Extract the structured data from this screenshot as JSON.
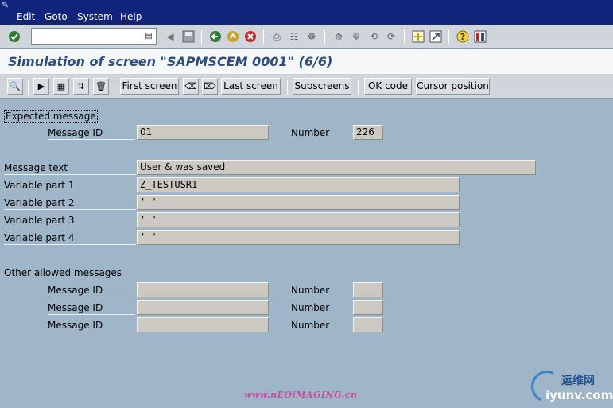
{
  "menubar": {
    "items": [
      {
        "label": "Edit",
        "mnemonic": "E"
      },
      {
        "label": "Goto",
        "mnemonic": "G"
      },
      {
        "label": "System",
        "mnemonic": "S"
      },
      {
        "label": "Help",
        "mnemonic": "H"
      }
    ]
  },
  "toolbar": {
    "command_value": "",
    "icons": [
      "enter-icon",
      "back-icon",
      "exit-icon",
      "cancel-icon",
      "print-icon",
      "find-icon",
      "find-next-icon",
      "first-page-icon",
      "previous-page-icon",
      "next-page-icon",
      "last-page-icon",
      "create-session-icon",
      "shortcut-icon",
      "help-icon",
      "layout-menu-icon"
    ]
  },
  "title": "Simulation of screen \"SAPMSCEM 0001\" (6/6)",
  "app_toolbar": {
    "first_screen": "First screen",
    "last_screen": "Last screen",
    "subscreens": "Subscreens",
    "ok_code": "OK code",
    "cursor_position": "Cursor position"
  },
  "expected": {
    "group_label": "Expected message",
    "message_id_label": "Message ID",
    "message_id": "01",
    "number_label": "Number",
    "number": "226",
    "message_text_label": "Message text",
    "message_text": "User & was saved",
    "var1_label": "Variable part 1",
    "var1": "Z_TESTUSR1",
    "var2_label": "Variable part 2",
    "var2": "' '",
    "var3_label": "Variable part 3",
    "var3": "' '",
    "var4_label": "Variable part 4",
    "var4": "' '"
  },
  "other": {
    "group_label": "Other allowed messages",
    "rows": [
      {
        "message_id_label": "Message ID",
        "message_id": "",
        "number_label": "Number",
        "number": ""
      },
      {
        "message_id_label": "Message ID",
        "message_id": "",
        "number_label": "Number",
        "number": ""
      },
      {
        "message_id_label": "Message ID",
        "message_id": "",
        "number_label": "Number",
        "number": ""
      }
    ]
  },
  "watermarks": {
    "center": "www.nEOiMAGING.cn",
    "corner_cn": "运维网",
    "corner_en": "iyunv.com"
  },
  "colors": {
    "menubar_bg": "#10247c",
    "title_color": "#2a4e83",
    "screen_bg": "#9eb6c8",
    "field_bg": "#cbc9c1"
  }
}
